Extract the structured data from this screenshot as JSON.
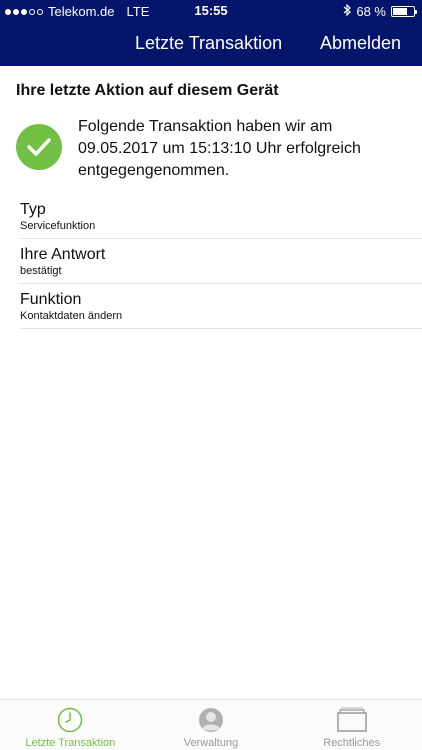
{
  "status_bar": {
    "carrier": "Telekom.de",
    "network": "LTE",
    "time": "15:55",
    "battery_text": "68 %",
    "battery_level": 0.68,
    "signal_bars_filled": 3,
    "signal_bars_total": 5
  },
  "nav": {
    "title": "Letzte Transaktion",
    "logout_label": "Abmelden",
    "background": "#04156b"
  },
  "section": {
    "title": "Ihre letzte Aktion auf diesem Gerät"
  },
  "confirmation": {
    "message": "Folgende Transaktion haben wir am 09.05.2017 um 15:13:10 Uhr erfolgreich entgegengenommen.",
    "icon": "check-icon",
    "color": "#72c043"
  },
  "details": [
    {
      "label": "Typ",
      "value": "Servicefunktion"
    },
    {
      "label": "Ihre Antwort",
      "value": "bestätigt"
    },
    {
      "label": "Funktion",
      "value": "Kontaktdaten ändern"
    }
  ],
  "tabs": [
    {
      "label": "Letzte Transaktion",
      "icon": "clock-icon",
      "active": true
    },
    {
      "label": "Verwaltung",
      "icon": "user-icon",
      "active": false
    },
    {
      "label": "Rechtliches",
      "icon": "folder-icon",
      "active": false
    }
  ]
}
